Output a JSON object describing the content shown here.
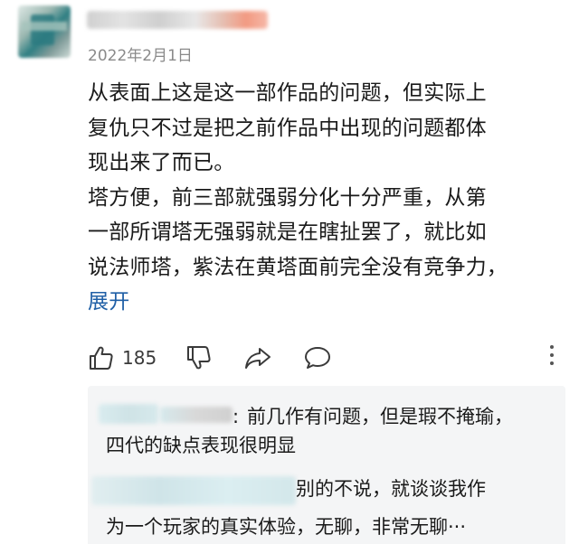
{
  "comment": {
    "date": "2022年2月1日",
    "lines": [
      "从表面上这是这一部作品的问题，但实际上",
      "复仇只不过是把之前作品中出现的问题都体",
      "现出来了而已。",
      "塔方便，前三部就强弱分化十分严重，从第",
      "一部所谓塔无强弱就是在瞎扯罢了，就比如",
      "说法师塔，紫法在黄塔面前完全没有竞争力，"
    ],
    "expand_label": "展开"
  },
  "actions": {
    "like_count": "185"
  },
  "replies": [
    {
      "separator": ":",
      "text_line1": "前几作有问题，但是瑕不掩瑜，",
      "text_line2": "四代的缺点表现很明显"
    },
    {
      "text_line1": "别的不说，就谈谈我作",
      "text_line2": "为一个玩家的真实体验，无聊，非常无聊···"
    }
  ]
}
